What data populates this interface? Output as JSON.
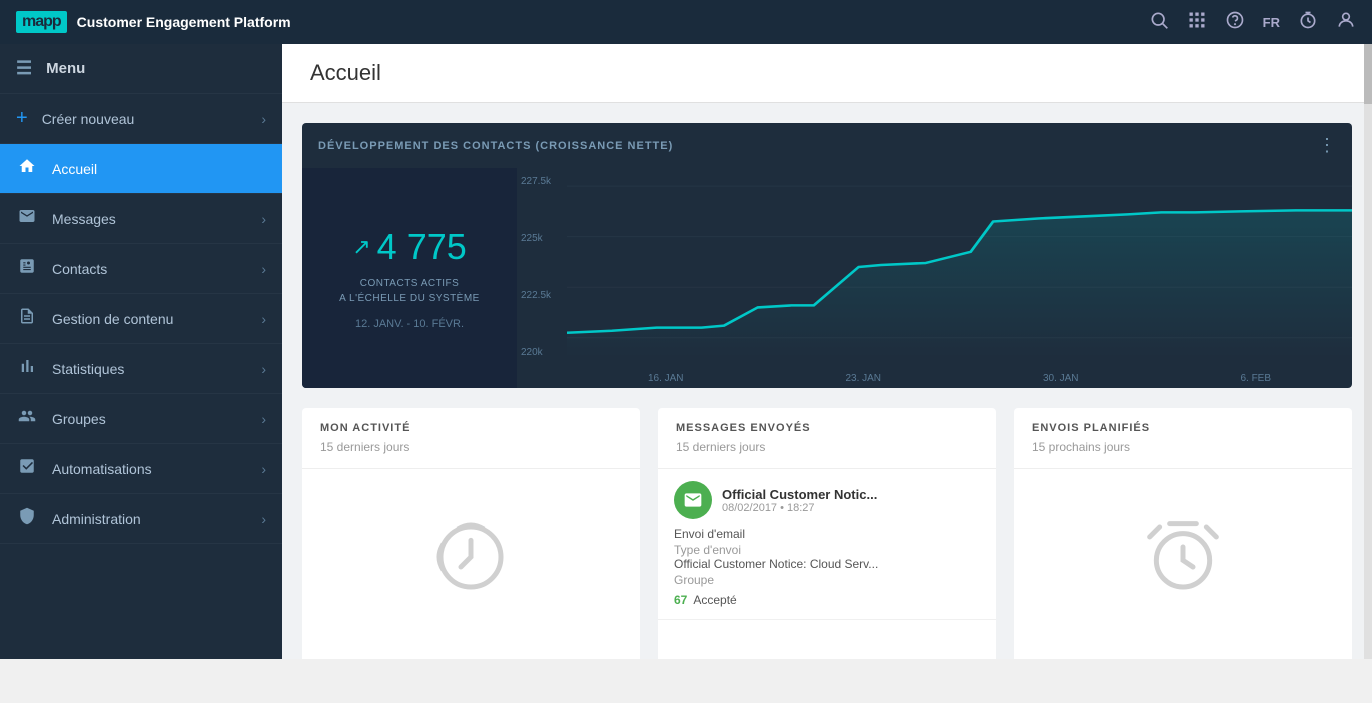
{
  "app": {
    "logo": "mapp",
    "title": "Customer Engagement Platform"
  },
  "topnav": {
    "icons": {
      "search": "🔍",
      "grid": "⊞",
      "help": "?",
      "lang": "FR",
      "clock": "⏱",
      "user": "👤"
    }
  },
  "sidebar": {
    "menu_label": "Menu",
    "items": [
      {
        "id": "creer-nouveau",
        "label": "Créer nouveau",
        "icon": "+",
        "has_chevron": true,
        "active": false
      },
      {
        "id": "accueil",
        "label": "Accueil",
        "icon": "⌂",
        "has_chevron": false,
        "active": true
      },
      {
        "id": "messages",
        "label": "Messages",
        "icon": "✉",
        "has_chevron": true,
        "active": false
      },
      {
        "id": "contacts",
        "label": "Contacts",
        "icon": "☰",
        "has_chevron": true,
        "active": false
      },
      {
        "id": "gestion-contenu",
        "label": "Gestion de contenu",
        "icon": "📄",
        "has_chevron": true,
        "active": false
      },
      {
        "id": "statistiques",
        "label": "Statistiques",
        "icon": "📊",
        "has_chevron": true,
        "active": false
      },
      {
        "id": "groupes",
        "label": "Groupes",
        "icon": "👥",
        "has_chevron": true,
        "active": false
      },
      {
        "id": "automatisations",
        "label": "Automatisations",
        "icon": "⚙",
        "has_chevron": true,
        "active": false
      },
      {
        "id": "administration",
        "label": "Administration",
        "icon": "🛡",
        "has_chevron": true,
        "active": false
      }
    ]
  },
  "page": {
    "title": "Accueil"
  },
  "chart": {
    "title": "DÉVELOPPEMENT DES CONTACTS (CROISSANCE NETTE)",
    "stat_value": "4 775",
    "stat_label": "CONTACTS ACTIFS\nA L'ÉCHELLE DU SYSTÈME",
    "date_range": "12. JANV. - 10. FÉVR.",
    "y_labels": [
      "227.5k",
      "225k",
      "222.5k",
      "220k"
    ],
    "x_labels": [
      "16. JAN",
      "23. JAN",
      "30. JAN",
      "6. FEB"
    ]
  },
  "cards": [
    {
      "id": "mon-activite",
      "title": "MON ACTIVITÉ",
      "subtitle": "15 derniers jours",
      "type": "clock"
    },
    {
      "id": "messages-envoyes",
      "title": "MESSAGES ENVOYÉS",
      "subtitle": "15 derniers jours",
      "type": "message",
      "message": {
        "name": "Official Customer Notic...",
        "date": "08/02/2017 • 18:27",
        "send_type_label": "Envoi d'email",
        "send_type_sub": "Type d'envoi",
        "group_label": "Official Customer Notice: Cloud Serv...",
        "group_sub": "Groupe",
        "stat_value": "67",
        "stat_label": "Accepté"
      }
    },
    {
      "id": "envois-planifies",
      "title": "ENVOIS PLANIFIÉS",
      "subtitle": "15 prochains jours",
      "type": "clock"
    }
  ]
}
